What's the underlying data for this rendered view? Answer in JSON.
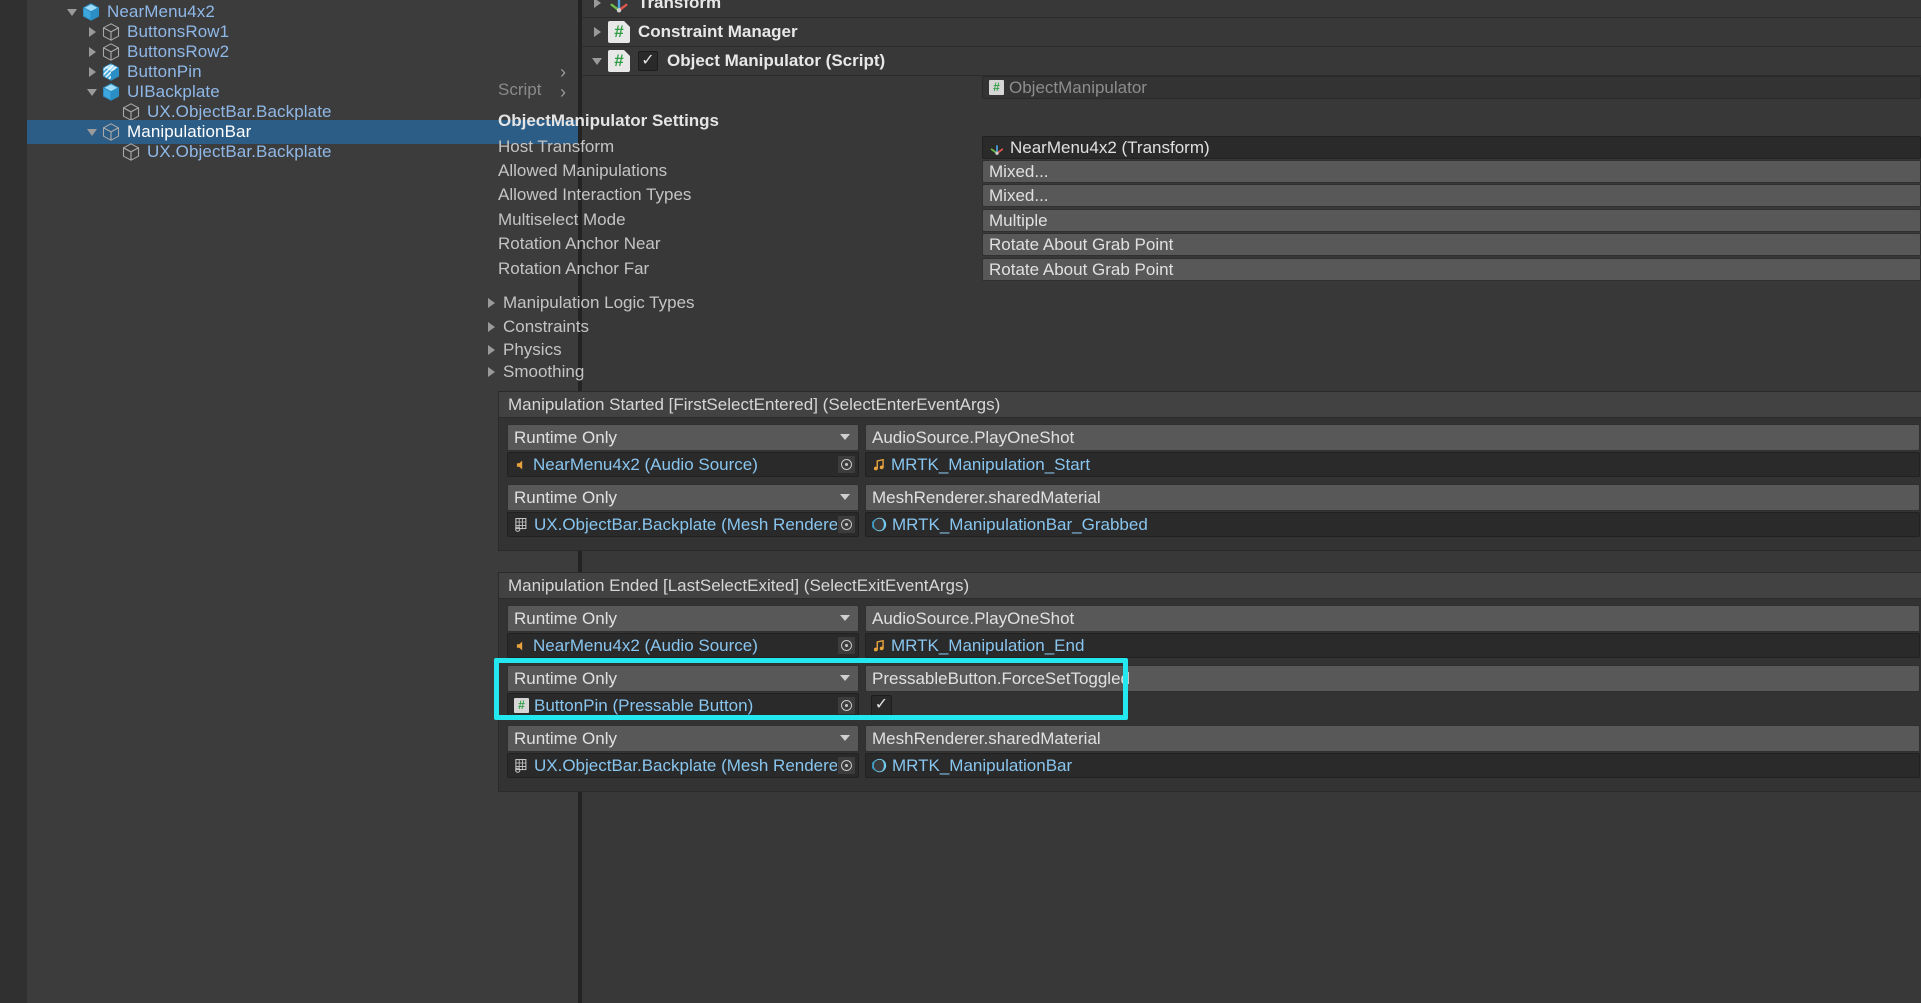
{
  "hierarchy": {
    "rows": [
      {
        "label": "NearMenu4x2",
        "indent": 0,
        "foldout": "down",
        "icon": "prefab-cube-icon",
        "selected": false,
        "chevron": false
      },
      {
        "label": "ButtonsRow1",
        "indent": 1,
        "foldout": "right",
        "icon": "gameobject-cube-icon",
        "selected": false,
        "chevron": false
      },
      {
        "label": "ButtonsRow2",
        "indent": 1,
        "foldout": "right",
        "icon": "gameobject-cube-icon",
        "selected": false,
        "chevron": false
      },
      {
        "label": "ButtonPin",
        "indent": 1,
        "foldout": "right",
        "icon": "prefab-variant-cube-icon",
        "selected": false,
        "chevron": true
      },
      {
        "label": "UIBackplate",
        "indent": 1,
        "foldout": "down",
        "icon": "prefab-cube-icon",
        "selected": false,
        "chevron": true
      },
      {
        "label": "UX.ObjectBar.Backplate",
        "indent": 2,
        "foldout": "none",
        "icon": "gameobject-cube-icon",
        "selected": false,
        "chevron": false
      },
      {
        "label": "ManipulationBar",
        "indent": 1,
        "foldout": "down",
        "icon": "gameobject-cube-icon",
        "selected": true,
        "chevron": false
      },
      {
        "label": "UX.ObjectBar.Backplate",
        "indent": 2,
        "foldout": "none",
        "icon": "gameobject-cube-icon",
        "selected": false,
        "chevron": false
      }
    ],
    "top_chevron": ">"
  },
  "inspector": {
    "components": [
      {
        "name": "Transform",
        "foldout": "right",
        "icon": "transform-icon",
        "has_enable_checkbox": false
      },
      {
        "name": "Constraint Manager",
        "foldout": "right",
        "icon": "script-icon",
        "has_enable_checkbox": false
      },
      {
        "name": "Object Manipulator (Script)",
        "foldout": "down",
        "icon": "script-icon",
        "has_enable_checkbox": true,
        "enabled": true
      }
    ],
    "script_row": {
      "label": "Script",
      "value": "ObjectManipulator",
      "icon": "script-icon",
      "readonly": true
    },
    "section_header": "ObjectManipulator Settings",
    "properties": [
      {
        "label": "Host Transform",
        "value": "NearMenu4x2 (Transform)",
        "control": "objectfield",
        "icon": "transform-icon"
      },
      {
        "label": "Allowed Manipulations",
        "value": "Mixed...",
        "control": "popup",
        "icon": "none"
      },
      {
        "label": "Allowed Interaction Types",
        "value": "Mixed...",
        "control": "popup",
        "icon": "none"
      },
      {
        "label": "Multiselect Mode",
        "value": "Multiple",
        "control": "popup",
        "icon": "none"
      },
      {
        "label": "Rotation Anchor Near",
        "value": "Rotate About Grab Point",
        "control": "popup",
        "icon": "none"
      },
      {
        "label": "Rotation Anchor Far",
        "value": "Rotate About Grab Point",
        "control": "popup",
        "icon": "none"
      }
    ],
    "foldouts": [
      {
        "label": "Manipulation Logic Types",
        "state": "collapsed"
      },
      {
        "label": "Constraints",
        "state": "collapsed"
      },
      {
        "label": "Physics",
        "state": "collapsed"
      },
      {
        "label": "Smoothing",
        "state": "collapsed"
      }
    ],
    "events": [
      {
        "title": "Manipulation Started [FirstSelectEntered] (SelectEnterEventArgs)",
        "entries": [
          {
            "mode": "Runtime Only",
            "method": "AudioSource.PlayOneShot",
            "target": "NearMenu4x2 (Audio Source)",
            "target_icon": "audiosource-icon",
            "argument": "MRTK_Manipulation_Start",
            "argument_icon": "audioclip-icon",
            "argument_type": "object",
            "highlighted": false
          },
          {
            "mode": "Runtime Only",
            "method": "MeshRenderer.sharedMaterial",
            "target": "UX.ObjectBar.Backplate (Mesh Renderer)",
            "target_icon": "meshrenderer-icon",
            "argument": "MRTK_ManipulationBar_Grabbed",
            "argument_icon": "material-icon",
            "argument_type": "object",
            "highlighted": false
          }
        ]
      },
      {
        "title": "Manipulation Ended [LastSelectExited] (SelectExitEventArgs)",
        "entries": [
          {
            "mode": "Runtime Only",
            "method": "AudioSource.PlayOneShot",
            "target": "NearMenu4x2 (Audio Source)",
            "target_icon": "audiosource-icon",
            "argument": "MRTK_Manipulation_End",
            "argument_icon": "audioclip-icon",
            "argument_type": "object",
            "highlighted": false
          },
          {
            "mode": "Runtime Only",
            "method": "PressableButton.ForceSetToggled",
            "target": "ButtonPin (Pressable Button)",
            "target_icon": "script-icon",
            "argument": "",
            "argument_icon": "none",
            "argument_type": "bool",
            "argument_bool": true,
            "highlighted": true
          },
          {
            "mode": "Runtime Only",
            "method": "MeshRenderer.sharedMaterial",
            "target": "UX.ObjectBar.Backplate (Mesh Renderer)",
            "target_icon": "meshrenderer-icon",
            "argument": "MRTK_ManipulationBar",
            "argument_icon": "material-icon",
            "argument_type": "object",
            "highlighted": false
          }
        ]
      }
    ]
  },
  "colors": {
    "highlight": "#24e8f0",
    "selection": "#2c5d87",
    "hierarchy_text": "#8fb8e8",
    "panel_bg": "#383838"
  }
}
